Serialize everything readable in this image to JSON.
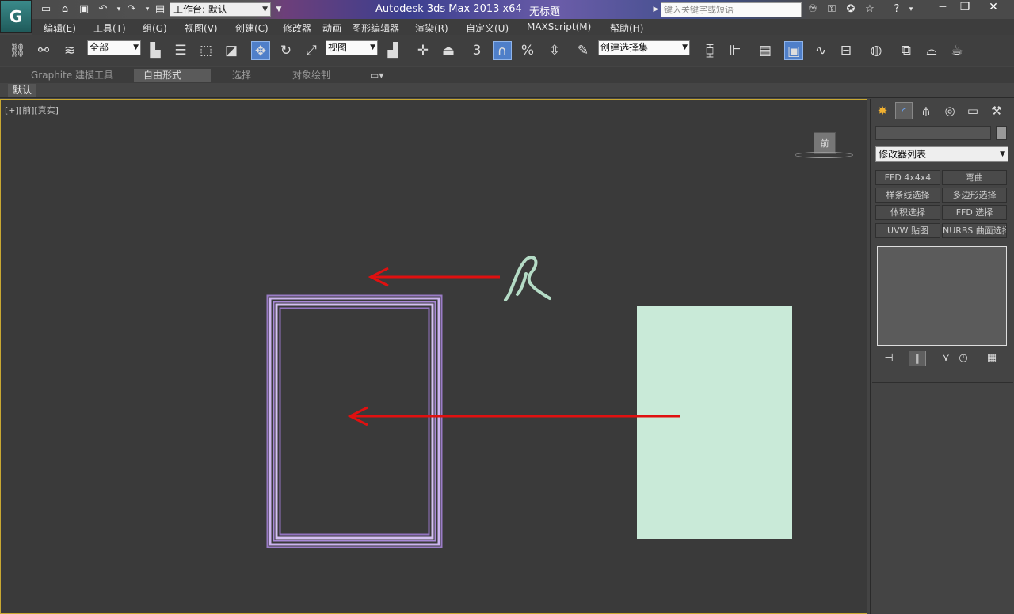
{
  "titlebar": {
    "workspace_label": "工作台: 默认",
    "app_title": "Autodesk 3ds Max  2013 x64",
    "doc_title": "无标题",
    "search_placeholder": "键入关键字或短语"
  },
  "menu": {
    "items": [
      "编辑(E)",
      "工具(T)",
      "组(G)",
      "视图(V)",
      "创建(C)",
      "修改器",
      "动画",
      "图形编辑器",
      "渲染(R)",
      "自定义(U)",
      "MAXScript(M)",
      "帮助(H)"
    ]
  },
  "toolbar": {
    "selection_filter": "全部",
    "ref_coord": "视图",
    "snap_angle_label": "3",
    "named_selection_set": "创建选择集"
  },
  "ribbon": {
    "tabs": [
      "Graphite 建模工具",
      "自由形式",
      "选择",
      "对象绘制"
    ],
    "active_tab": "自由形式",
    "sub_label": "默认"
  },
  "viewport": {
    "label": "[+][前][真实]",
    "viewcube_face": "前",
    "colors": {
      "frame": "#b89ae0",
      "plane": "#c9ead8",
      "spline": "#b5dcc6",
      "arrow": "#e01010"
    }
  },
  "command_panel": {
    "modifier_list": "修改器列表",
    "modifier_buttons": [
      "FFD 4x4x4",
      "弯曲",
      "样条线选择",
      "多边形选择",
      "体积选择",
      "FFD 选择",
      "UVW 贴图",
      "NURBS 曲面选择"
    ]
  }
}
